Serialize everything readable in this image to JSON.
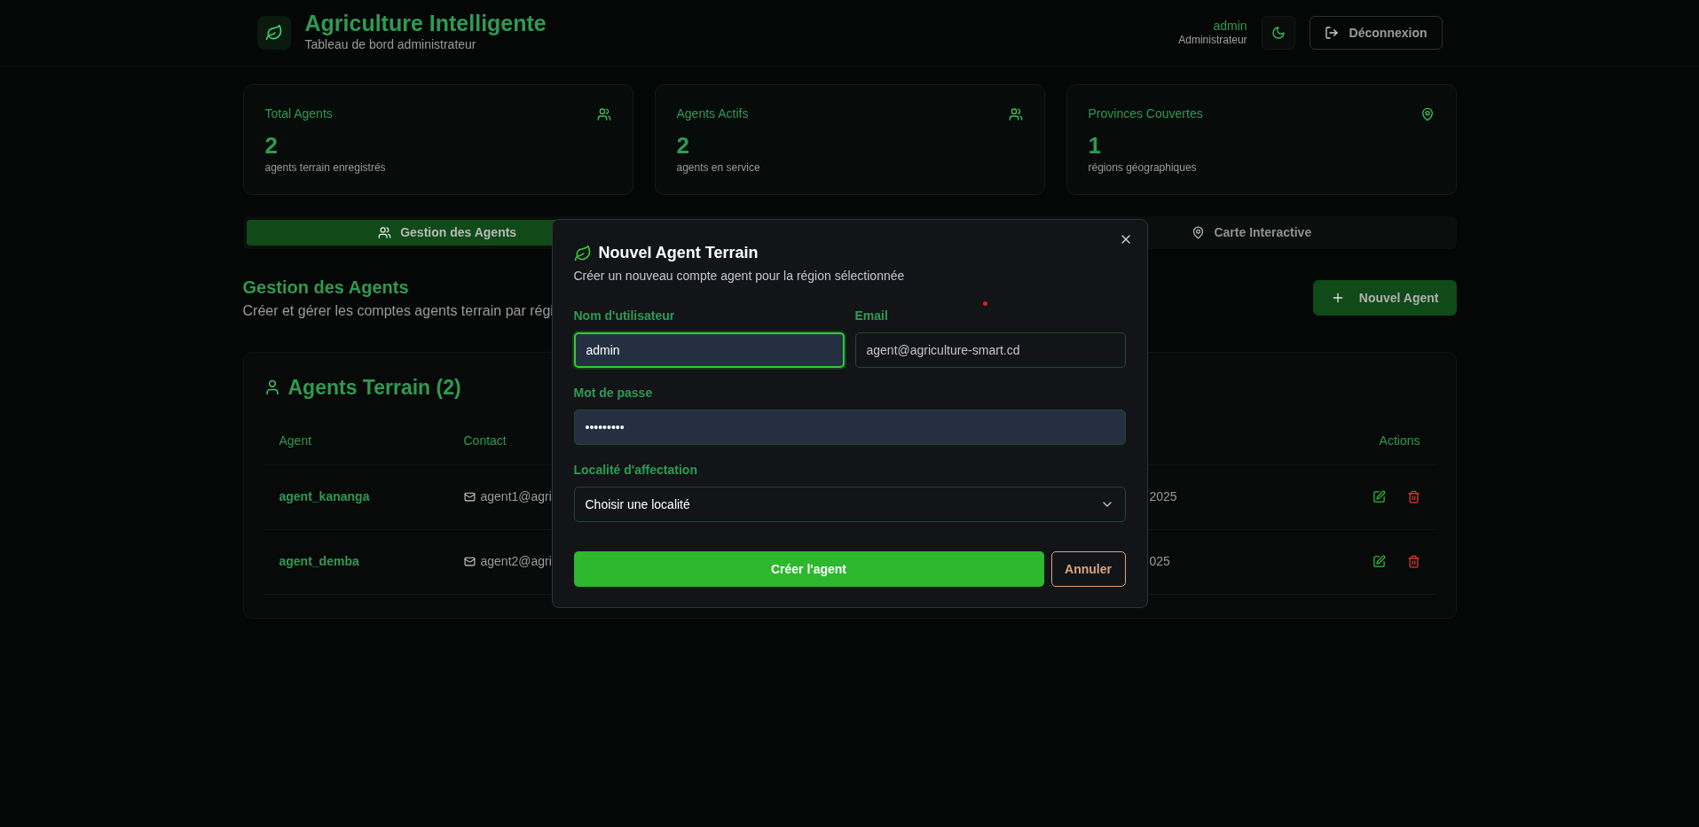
{
  "header": {
    "title": "Agriculture Intelligente",
    "subtitle": "Tableau de bord administrateur",
    "user_name": "admin",
    "user_role": "Administrateur",
    "logout_label": "Déconnexion"
  },
  "stats": [
    {
      "title": "Total Agents",
      "value": "2",
      "caption": "agents terrain enregistrés",
      "kind": "users"
    },
    {
      "title": "Agents Actifs",
      "value": "2",
      "caption": "agents en service",
      "kind": "users"
    },
    {
      "title": "Provinces Couvertes",
      "value": "1",
      "caption": "régions géographiques",
      "kind": "pin"
    }
  ],
  "tabs": [
    {
      "label": "Gestion des Agents",
      "kind": "users",
      "selected": true
    },
    {
      "label": "Carte Interactive",
      "kind": "pin",
      "selected": false
    }
  ],
  "section": {
    "title": "Gestion des Agents",
    "subtitle": "Créer et gérer les comptes agents terrain par régi",
    "new_button": "Nouvel Agent"
  },
  "table": {
    "title": "Agents Terrain (2)",
    "columns": [
      "Agent",
      "Contact",
      "Actions"
    ],
    "rows": [
      {
        "agent": "agent_kananga",
        "contact": "agent1@agri",
        "column_3": "2025"
      },
      {
        "agent": "agent_demba",
        "contact": "agent2@agri",
        "column_3": "025"
      }
    ]
  },
  "dialog": {
    "title": "Nouvel Agent Terrain",
    "subtitle": "Créer un nouveau compte agent pour la région sélectionnée",
    "fields": [
      {
        "label": "Nom d'utilisateur",
        "kind": "text",
        "value": "admin",
        "focused": true
      },
      {
        "label": "Email",
        "kind": "text",
        "placeholder": "agent@agriculture-smart.cd",
        "focused": false
      },
      {
        "label": "Mot de passe",
        "kind": "text",
        "value": "•••••••••",
        "focused": false,
        "wide": true
      },
      {
        "label": "Localité d'affectation",
        "kind": "select",
        "value": "Choisir une localité",
        "focused": false,
        "wide": true
      }
    ],
    "submit": "Créer l'agent",
    "cancel": "Annuler"
  }
}
